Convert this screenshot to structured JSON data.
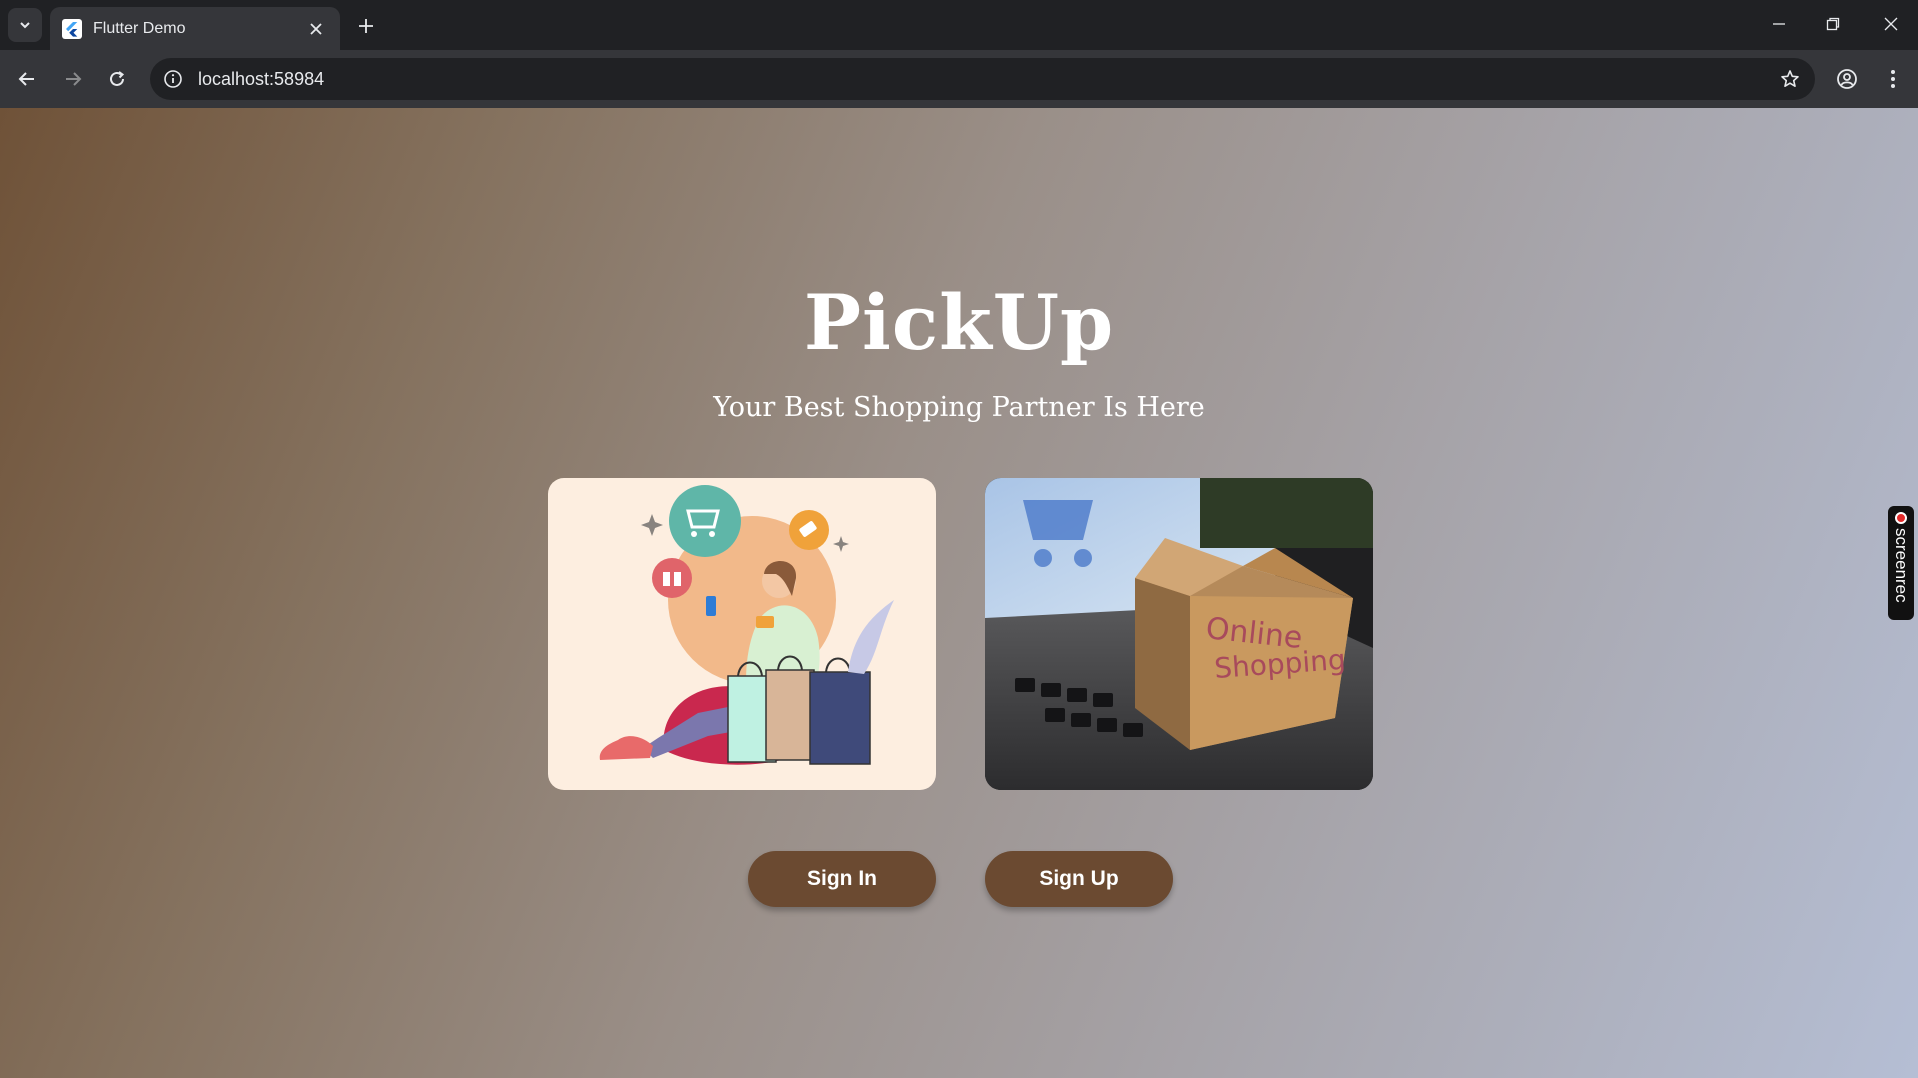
{
  "browser": {
    "tab_title": "Flutter Demo",
    "url": "localhost:58984"
  },
  "page": {
    "title": "PickUp",
    "subtitle": "Your Best Shopping Partner Is Here",
    "cards": [
      {
        "name": "shopping-illustration",
        "description": "woman with shopping bags"
      },
      {
        "name": "online-shopping-photo",
        "box_text_line1": "Online",
        "box_text_line2": "Shopping"
      }
    ],
    "buttons": {
      "sign_in": "Sign In",
      "sign_up": "Sign Up"
    }
  },
  "overlay": {
    "screenrec_label": "screenrec"
  },
  "colors": {
    "button_bg": "#6b4a31",
    "gradient_start": "#6f5238",
    "gradient_end": "#b5bed4"
  }
}
